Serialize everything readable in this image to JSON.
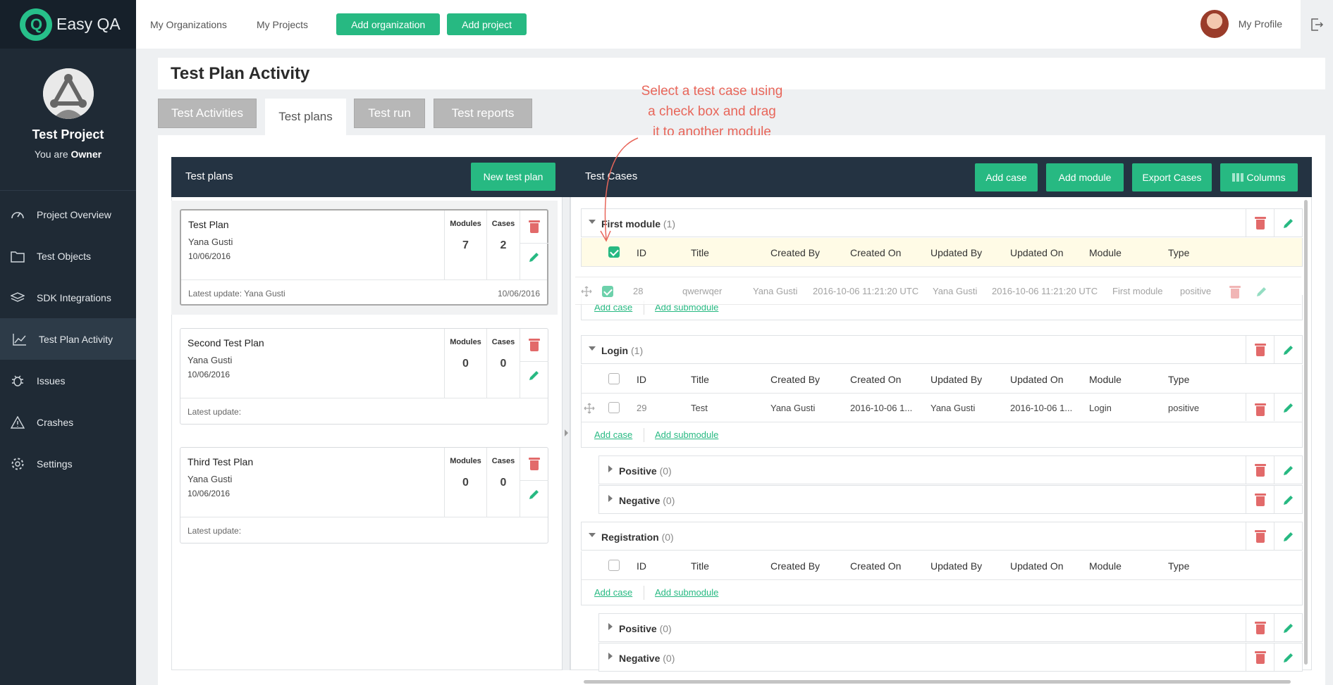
{
  "app": {
    "name": "Easy QA"
  },
  "sidebar": {
    "project_name": "Test Project",
    "role_prefix": "You are",
    "role": "Owner",
    "items": [
      {
        "label": "Project Overview",
        "icon": "gauge-icon"
      },
      {
        "label": "Test Objects",
        "icon": "folder-icon"
      },
      {
        "label": "SDK Integrations",
        "icon": "layers-icon"
      },
      {
        "label": "Test Plan Activity",
        "icon": "chart-line-icon",
        "active": true
      },
      {
        "label": "Issues",
        "icon": "bug-icon"
      },
      {
        "label": "Crashes",
        "icon": "warning-icon"
      },
      {
        "label": "Settings",
        "icon": "gear-icon"
      }
    ]
  },
  "topbar": {
    "links": [
      "My Organizations",
      "My Projects"
    ],
    "buttons": [
      "Add organization",
      "Add project"
    ],
    "profile_label": "My Profile"
  },
  "page": {
    "title": "Test Plan Activity"
  },
  "tabs": [
    {
      "label": "Test Activities",
      "active": false
    },
    {
      "label": "Test plans",
      "active": true
    },
    {
      "label": "Test run",
      "active": false
    },
    {
      "label": "Test reports",
      "active": false
    }
  ],
  "annotation": {
    "line1": "Select a test case using",
    "line2": "a check box and drag",
    "line3": "it to another module"
  },
  "left_panel": {
    "title": "Test plans",
    "new_button": "New test plan",
    "col_modules": "Modules",
    "col_cases": "Cases",
    "plans": [
      {
        "name": "Test Plan",
        "author": "Yana Gusti",
        "date": "10/06/2016",
        "modules": "7",
        "cases": "2",
        "latest": "Latest update: Yana Gusti",
        "latest_date": "10/06/2016"
      },
      {
        "name": "Second Test Plan",
        "author": "Yana Gusti",
        "date": "10/06/2016",
        "modules": "0",
        "cases": "0",
        "latest": "Latest update:",
        "latest_date": ""
      },
      {
        "name": "Third Test Plan",
        "author": "Yana Gusti",
        "date": "10/06/2016",
        "modules": "0",
        "cases": "0",
        "latest": "Latest update:",
        "latest_date": ""
      }
    ]
  },
  "right_panel": {
    "title": "Test Cases",
    "buttons": [
      "Add case",
      "Add module",
      "Export Cases",
      "Columns"
    ],
    "columns": [
      "ID",
      "Title",
      "Created By",
      "Created On",
      "Updated By",
      "Updated On",
      "Module",
      "Type"
    ],
    "add_case": "Add case",
    "add_submodule": "Add submodule",
    "modules": [
      {
        "name": "First module",
        "count": "(1)"
      },
      {
        "name": "Login",
        "count": "(1)"
      },
      {
        "name": "Positive",
        "count": "(0)"
      },
      {
        "name": "Negative",
        "count": "(0)"
      },
      {
        "name": "Registration",
        "count": "(0)"
      },
      {
        "name": "Positive",
        "count": "(0)"
      },
      {
        "name": "Negative",
        "count": "(0)"
      }
    ],
    "dragging_row": {
      "id": "28",
      "title": "qwerwqer",
      "created_by": "Yana Gusti",
      "created_on": "2016-10-06 11:21:20 UTC",
      "updated_by": "Yana Gusti",
      "updated_on": "2016-10-06 11:21:20 UTC",
      "module": "First module",
      "type": "positive"
    },
    "login_row": {
      "id": "29",
      "title": "Test",
      "created_by": "Yana Gusti",
      "created_on": "2016-10-06 1...",
      "updated_by": "Yana Gusti",
      "updated_on": "2016-10-06 1...",
      "module": "Login",
      "type": "positive"
    }
  },
  "colors": {
    "accent": "#27b982",
    "sidebar": "#1f2a35",
    "header": "#243342",
    "danger": "#e26a6a",
    "annotation": "#e8665a"
  }
}
